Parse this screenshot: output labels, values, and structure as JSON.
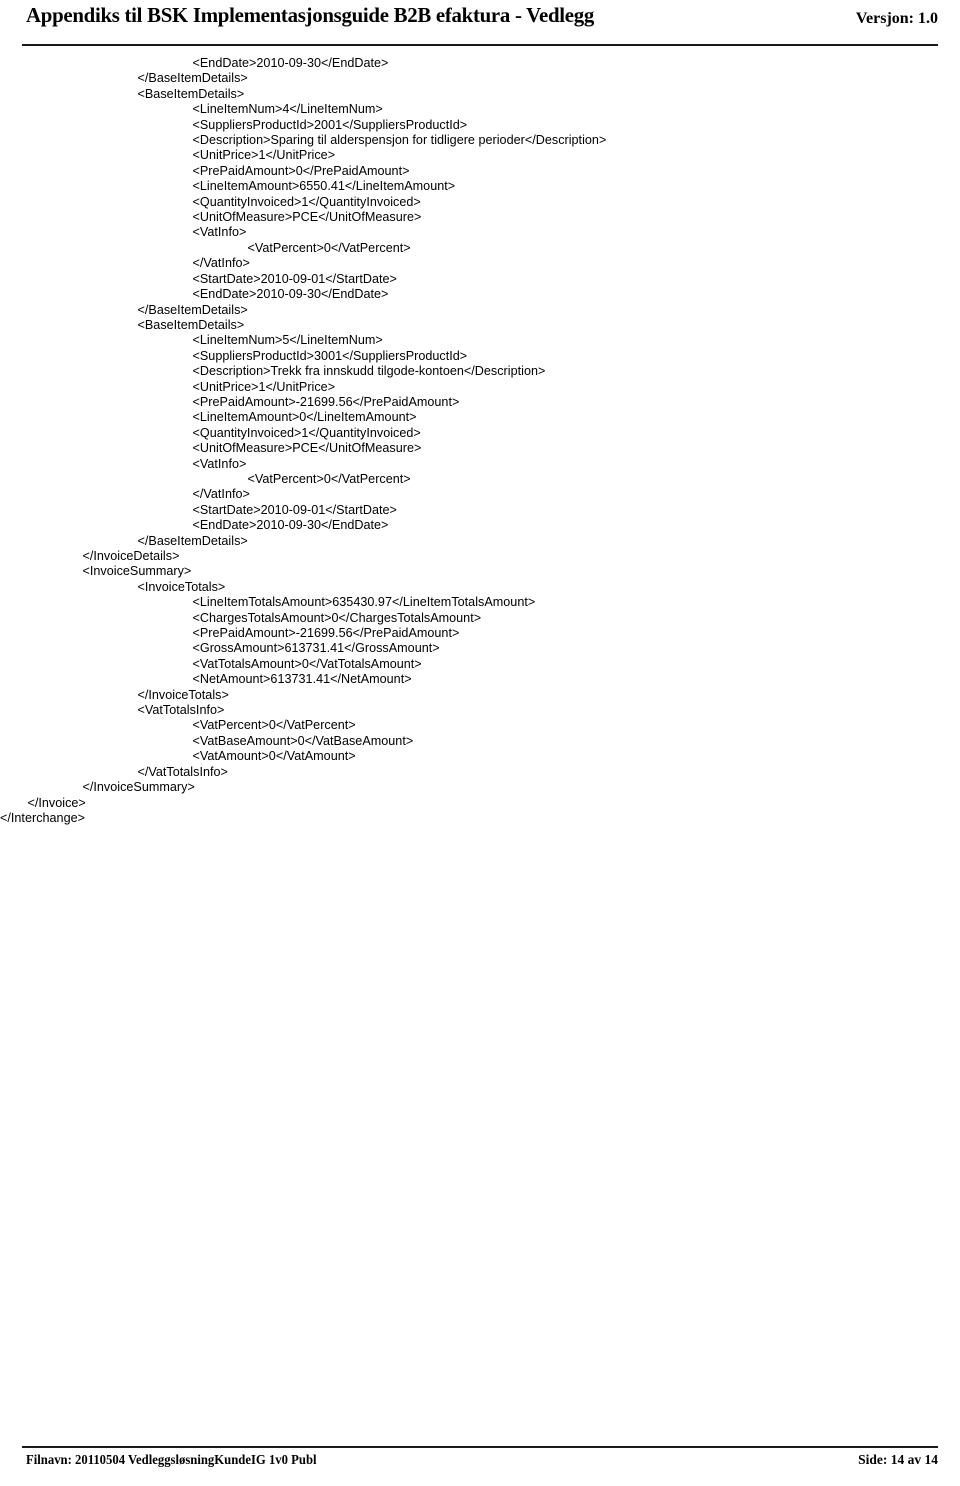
{
  "header": {
    "title": "Appendiks til BSK Implementasjonsguide B2B efaktura - Vedlegg",
    "version": "Versjon: 1.0"
  },
  "footer": {
    "filename": "Filnavn: 20110504 VedleggsløsningKundeIG 1v0 Publ",
    "page": "Side: 14 av 14"
  },
  "xml_listing": [
    {
      "indent": 7,
      "text": "<EndDate>2010-09-30</EndDate>"
    },
    {
      "indent": 5,
      "text": "</BaseItemDetails>"
    },
    {
      "indent": 5,
      "text": "<BaseItemDetails>"
    },
    {
      "indent": 7,
      "text": "<LineItemNum>4</LineItemNum>"
    },
    {
      "indent": 7,
      "text": "<SuppliersProductId>2001</SuppliersProductId>"
    },
    {
      "indent": 7,
      "text": "<Description>Sparing til alderspensjon for tidligere perioder</Description>"
    },
    {
      "indent": 7,
      "text": "<UnitPrice>1</UnitPrice>"
    },
    {
      "indent": 7,
      "text": "<PrePaidAmount>0</PrePaidAmount>"
    },
    {
      "indent": 7,
      "text": "<LineItemAmount>6550.41</LineItemAmount>"
    },
    {
      "indent": 7,
      "text": "<QuantityInvoiced>1</QuantityInvoiced>"
    },
    {
      "indent": 7,
      "text": "<UnitOfMeasure>PCE</UnitOfMeasure>"
    },
    {
      "indent": 7,
      "text": "<VatInfo>"
    },
    {
      "indent": 9,
      "text": "<VatPercent>0</VatPercent>"
    },
    {
      "indent": 7,
      "text": "</VatInfo>"
    },
    {
      "indent": 7,
      "text": "<StartDate>2010-09-01</StartDate>"
    },
    {
      "indent": 7,
      "text": "<EndDate>2010-09-30</EndDate>"
    },
    {
      "indent": 5,
      "text": "</BaseItemDetails>"
    },
    {
      "indent": 5,
      "text": "<BaseItemDetails>"
    },
    {
      "indent": 7,
      "text": "<LineItemNum>5</LineItemNum>"
    },
    {
      "indent": 7,
      "text": "<SuppliersProductId>3001</SuppliersProductId>"
    },
    {
      "indent": 7,
      "text": "<Description>Trekk fra innskudd tilgode-kontoen</Description>"
    },
    {
      "indent": 7,
      "text": "<UnitPrice>1</UnitPrice>"
    },
    {
      "indent": 7,
      "text": "<PrePaidAmount>-21699.56</PrePaidAmount>"
    },
    {
      "indent": 7,
      "text": "<LineItemAmount>0</LineItemAmount>"
    },
    {
      "indent": 7,
      "text": "<QuantityInvoiced>1</QuantityInvoiced>"
    },
    {
      "indent": 7,
      "text": "<UnitOfMeasure>PCE</UnitOfMeasure>"
    },
    {
      "indent": 7,
      "text": "<VatInfo>"
    },
    {
      "indent": 9,
      "text": "<VatPercent>0</VatPercent>"
    },
    {
      "indent": 7,
      "text": "</VatInfo>"
    },
    {
      "indent": 7,
      "text": "<StartDate>2010-09-01</StartDate>"
    },
    {
      "indent": 7,
      "text": "<EndDate>2010-09-30</EndDate>"
    },
    {
      "indent": 5,
      "text": "</BaseItemDetails>"
    },
    {
      "indent": 3,
      "text": "</InvoiceDetails>"
    },
    {
      "indent": 3,
      "text": "<InvoiceSummary>"
    },
    {
      "indent": 5,
      "text": "<InvoiceTotals>"
    },
    {
      "indent": 7,
      "text": "<LineItemTotalsAmount>635430.97</LineItemTotalsAmount>"
    },
    {
      "indent": 7,
      "text": "<ChargesTotalsAmount>0</ChargesTotalsAmount>"
    },
    {
      "indent": 7,
      "text": "<PrePaidAmount>-21699.56</PrePaidAmount>"
    },
    {
      "indent": 7,
      "text": "<GrossAmount>613731.41</GrossAmount>"
    },
    {
      "indent": 7,
      "text": "<VatTotalsAmount>0</VatTotalsAmount>"
    },
    {
      "indent": 7,
      "text": "<NetAmount>613731.41</NetAmount>"
    },
    {
      "indent": 5,
      "text": "</InvoiceTotals>"
    },
    {
      "indent": 5,
      "text": "<VatTotalsInfo>"
    },
    {
      "indent": 7,
      "text": "<VatPercent>0</VatPercent>"
    },
    {
      "indent": 7,
      "text": "<VatBaseAmount>0</VatBaseAmount>"
    },
    {
      "indent": 7,
      "text": "<VatAmount>0</VatAmount>"
    },
    {
      "indent": 5,
      "text": "</VatTotalsInfo>"
    },
    {
      "indent": 3,
      "text": "</InvoiceSummary>"
    },
    {
      "indent": 1,
      "text": "</Invoice>"
    },
    {
      "indent": 0,
      "text": "</Interchange>"
    }
  ]
}
